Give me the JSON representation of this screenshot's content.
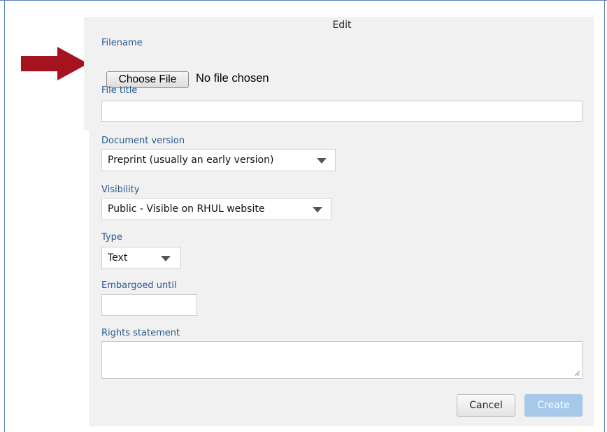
{
  "dialog": {
    "title": "Edit"
  },
  "fields": {
    "filename_label": "Filename",
    "choose_file_label": "Choose File",
    "file_status": "No file chosen",
    "file_title_label": "File title",
    "file_title_value": "",
    "document_version_label": "Document version",
    "document_version_value": "Preprint (usually an early version)",
    "visibility_label": "Visibility",
    "visibility_value": "Public - Visible on RHUL website",
    "type_label": "Type",
    "type_value": "Text",
    "embargoed_label": "Embargoed until",
    "embargoed_value": "",
    "rights_label": "Rights statement",
    "rights_value": ""
  },
  "actions": {
    "cancel_label": "Cancel",
    "create_label": "Create"
  },
  "colors": {
    "label": "#2a5a8f",
    "arrow": "#a5141e",
    "create_disabled": "#a6c9ea"
  },
  "icons": {
    "pointer": "red-arrow-icon",
    "dropdown": "chevron-down-icon",
    "resize": "resize-grip-icon"
  }
}
